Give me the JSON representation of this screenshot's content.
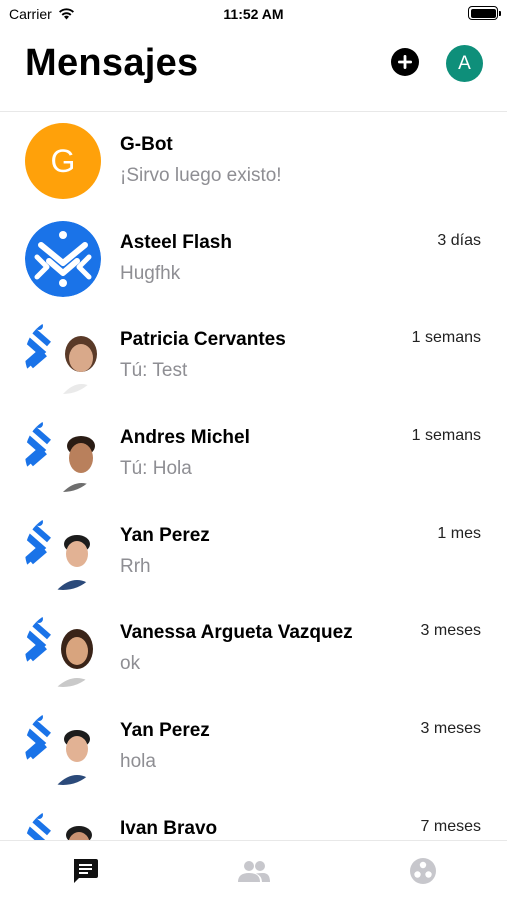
{
  "status_bar": {
    "carrier": "Carrier",
    "time": "11:52 AM",
    "battery_level": 1.0
  },
  "header": {
    "title": "Mensajes",
    "profile_initial": "A",
    "accent": "#0e8f7a"
  },
  "conversations": [
    {
      "name": "G-Bot",
      "snippet": "¡Sirvo luego existo!",
      "time": "",
      "initial": "G",
      "avatar": "letter"
    },
    {
      "name": "Asteel Flash",
      "snippet": "Hugfhk",
      "time": "3 días",
      "avatar": "logo"
    },
    {
      "name": "Patricia Cervantes",
      "snippet": "Tú: Test",
      "time": "1 semans",
      "avatar": "photo"
    },
    {
      "name": "Andres Michel",
      "snippet": "Tú: Hola",
      "time": "1 semans",
      "avatar": "photo"
    },
    {
      "name": "Yan Perez",
      "snippet": "Rrh",
      "time": "1 mes",
      "avatar": "photo"
    },
    {
      "name": "Vanessa Argueta Vazquez",
      "snippet": "ok",
      "time": "3 meses",
      "avatar": "photo"
    },
    {
      "name": "Yan Perez",
      "snippet": "hola",
      "time": "3 meses",
      "avatar": "photo"
    },
    {
      "name": "Ivan Bravo",
      "snippet": "",
      "time": "7 meses",
      "avatar": "photo"
    }
  ],
  "tabs": [
    {
      "icon": "chat-icon",
      "active": true
    },
    {
      "icon": "people-icon",
      "active": false
    },
    {
      "icon": "community-icon",
      "active": false
    }
  ],
  "colors": {
    "brand_blue": "#1a73e8",
    "bot_orange": "#ffa10a",
    "muted_text": "#8e8e93"
  }
}
